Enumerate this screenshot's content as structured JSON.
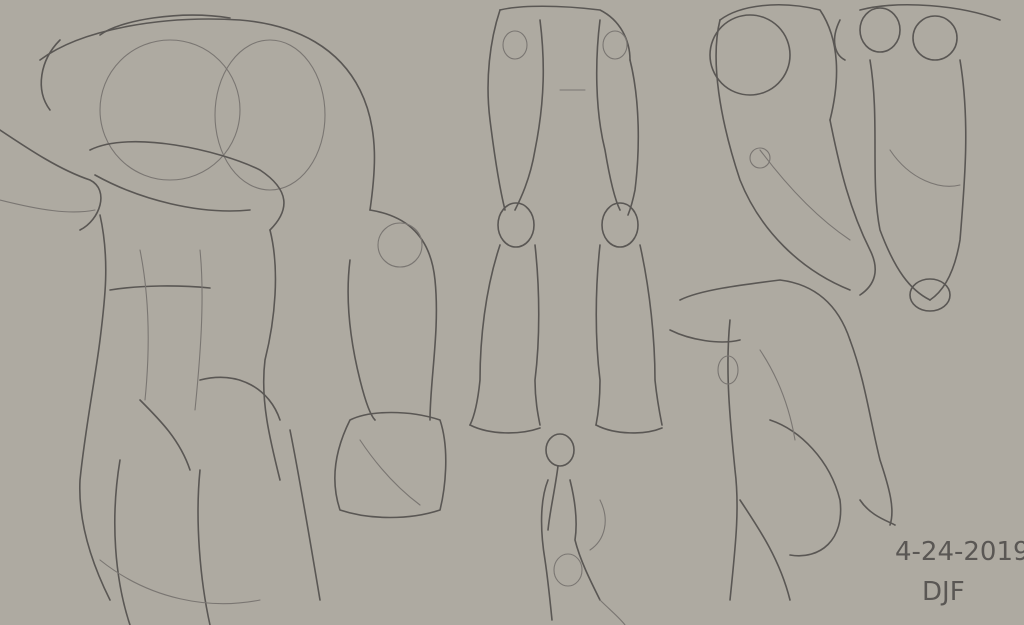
{
  "image": {
    "background_color": "#aeaaa1",
    "stroke_color": "#5a5754",
    "stroke_light_color": "#7a7672"
  },
  "annotations": {
    "date": "4-24-2019",
    "signature": "DJF"
  }
}
